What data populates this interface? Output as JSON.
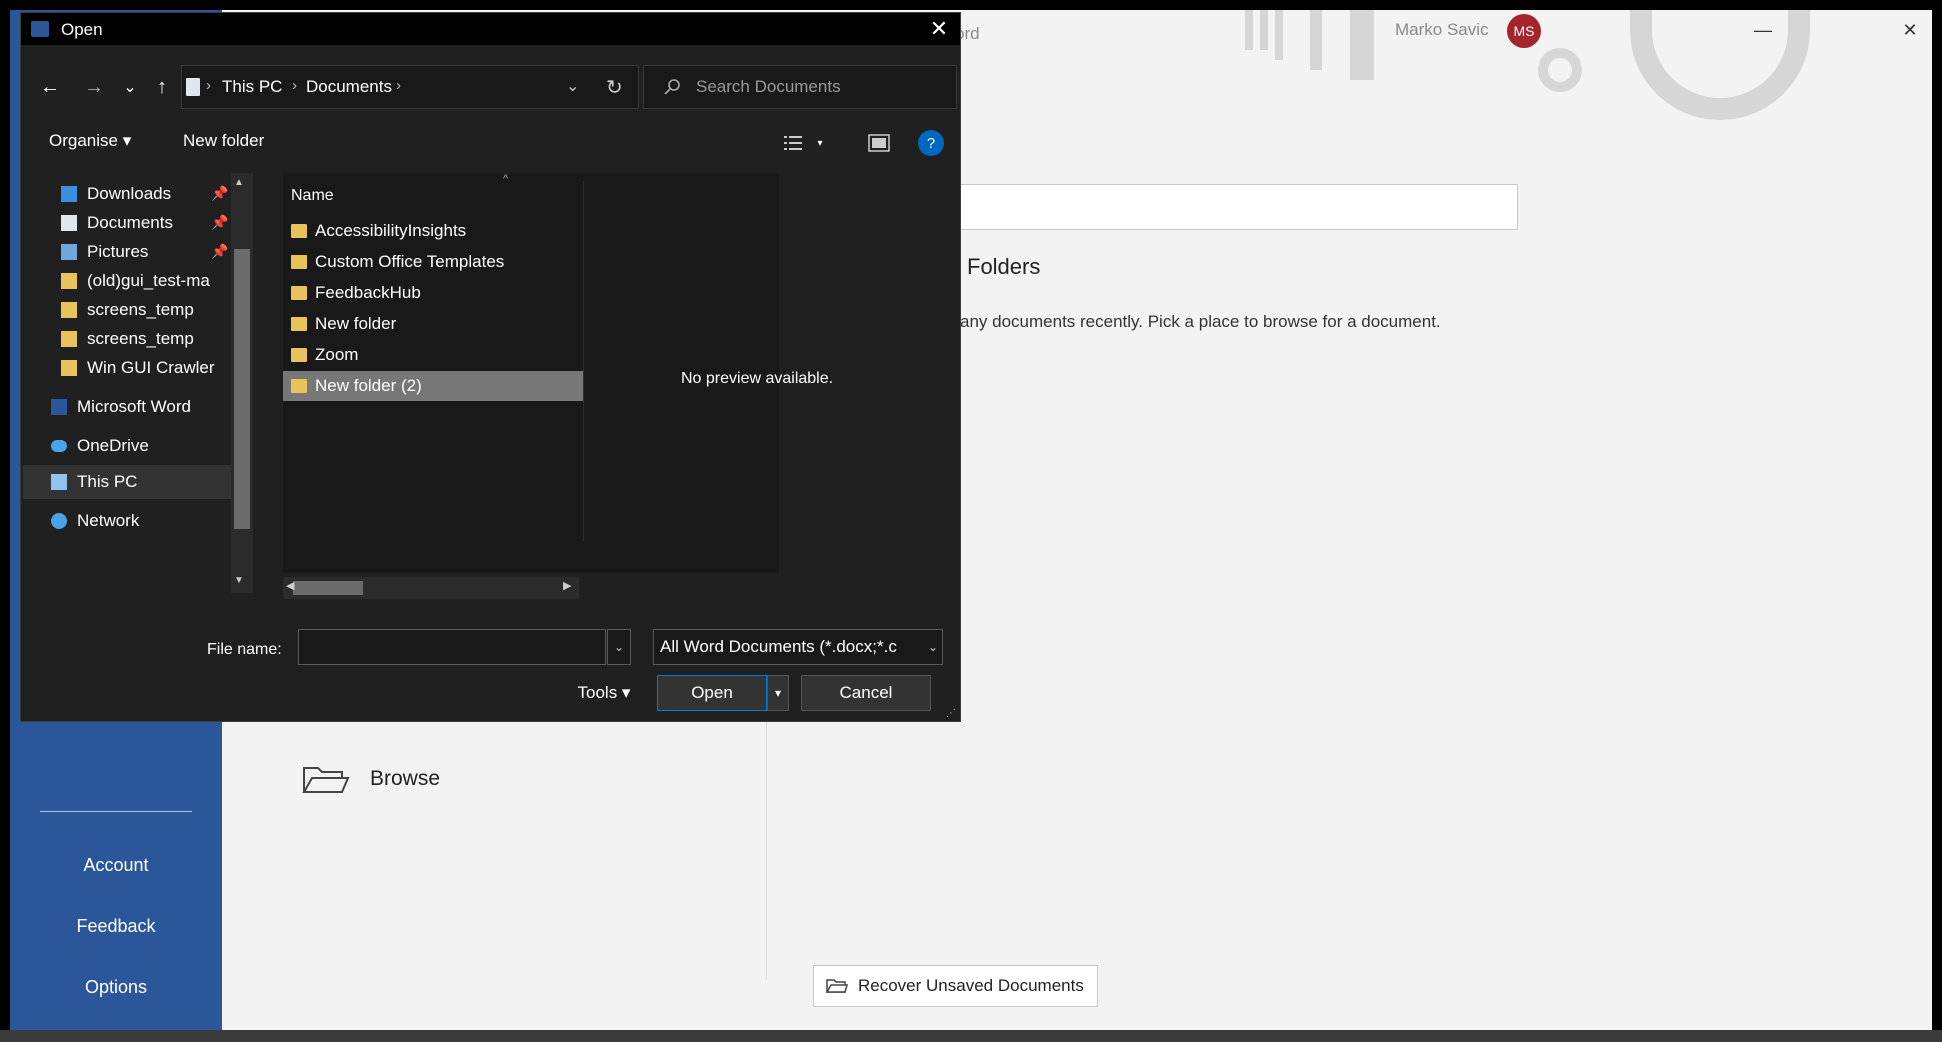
{
  "word": {
    "title_fragment": "ord",
    "user_name": "Marko Savic",
    "user_initials": "MS",
    "folders_heading": "Folders",
    "recent_message": "any documents recently. Pick a place to browse for a document.",
    "browse_label": "Browse",
    "recover_label": "Recover Unsaved Documents",
    "sidebar": {
      "account": "Account",
      "feedback": "Feedback",
      "options": "Options"
    },
    "window_controls": {
      "minimize": "—",
      "close": "✕"
    }
  },
  "dialog": {
    "title": "Open",
    "close_glyph": "✕",
    "nav": {
      "back": "←",
      "forward": "→",
      "history": "⌄",
      "up": "↑",
      "refresh": "↻",
      "address_drop": "⌄"
    },
    "breadcrumbs": [
      "This PC",
      "Documents"
    ],
    "crumb_sep": "›",
    "search_placeholder": "Search Documents",
    "toolbar": {
      "organise": "Organise ▾",
      "new_folder": "New folder",
      "help": "?"
    },
    "nav_pane": [
      {
        "label": "Downloads",
        "pinned": true,
        "icon": "download-icon"
      },
      {
        "label": "Documents",
        "pinned": true,
        "icon": "documents-icon"
      },
      {
        "label": "Pictures",
        "pinned": true,
        "icon": "pictures-icon"
      },
      {
        "label": "(old)gui_test-ma",
        "pinned": false,
        "icon": "folder-icon"
      },
      {
        "label": "screens_temp",
        "pinned": false,
        "icon": "folder-icon"
      },
      {
        "label": "screens_temp",
        "pinned": false,
        "icon": "folder-icon"
      },
      {
        "label": "Win GUI Crawler",
        "pinned": false,
        "icon": "folder-icon"
      },
      {
        "label": "Microsoft Word",
        "pinned": false,
        "icon": "word-icon"
      },
      {
        "label": "OneDrive",
        "pinned": false,
        "icon": "cloud-icon"
      },
      {
        "label": "This PC",
        "pinned": false,
        "icon": "computer-icon"
      },
      {
        "label": "Network",
        "pinned": false,
        "icon": "network-icon"
      }
    ],
    "pin_glyph": "📌",
    "column_name": "Name",
    "files": [
      "AccessibilityInsights",
      "Custom Office Templates",
      "FeedbackHub",
      "New folder",
      "Zoom",
      "New folder (2)"
    ],
    "selected_file_index": 5,
    "preview_text": "No preview available.",
    "file_name_label": "File name:",
    "file_name_value": "",
    "filter": "All Word Documents (*.docx;*.c",
    "tools": "Tools ▾",
    "open": "Open",
    "open_drop": "▾",
    "cancel": "Cancel"
  }
}
